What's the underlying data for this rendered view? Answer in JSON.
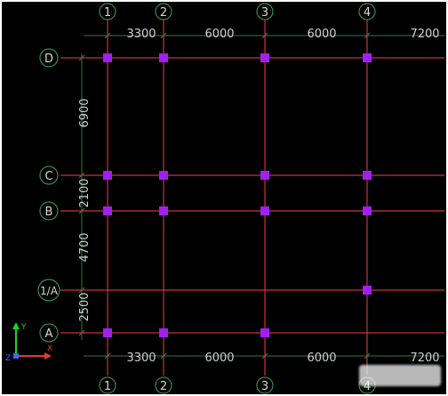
{
  "canvas": {
    "background": "#000000",
    "grid_line_color": "#c8323c",
    "axis_line_color": "#2f7a3a",
    "bubble_color": "#3c8c46",
    "column_color": "#a020f0",
    "text_color": "#d6d6d6"
  },
  "axes_vertical": [
    {
      "label": "1"
    },
    {
      "label": "2"
    },
    {
      "label": "3"
    },
    {
      "label": "4"
    }
  ],
  "axes_horizontal": [
    {
      "label": "D"
    },
    {
      "label": "C"
    },
    {
      "label": "B"
    },
    {
      "label": "1/A"
    },
    {
      "label": "A"
    }
  ],
  "dimensions_top": [
    "3300",
    "6000",
    "6000",
    "7200"
  ],
  "dimensions_bottom": [
    "3300",
    "6000",
    "6000",
    "7200"
  ],
  "dimensions_left": [
    "6900",
    "2100",
    "4700",
    "2500"
  ],
  "ucs": {
    "y_label": "Y",
    "x_label": "X",
    "z_label": "Z",
    "y_color": "#1fd11f",
    "x_color": "#e23b2b",
    "z_color": "#3a6cff"
  }
}
